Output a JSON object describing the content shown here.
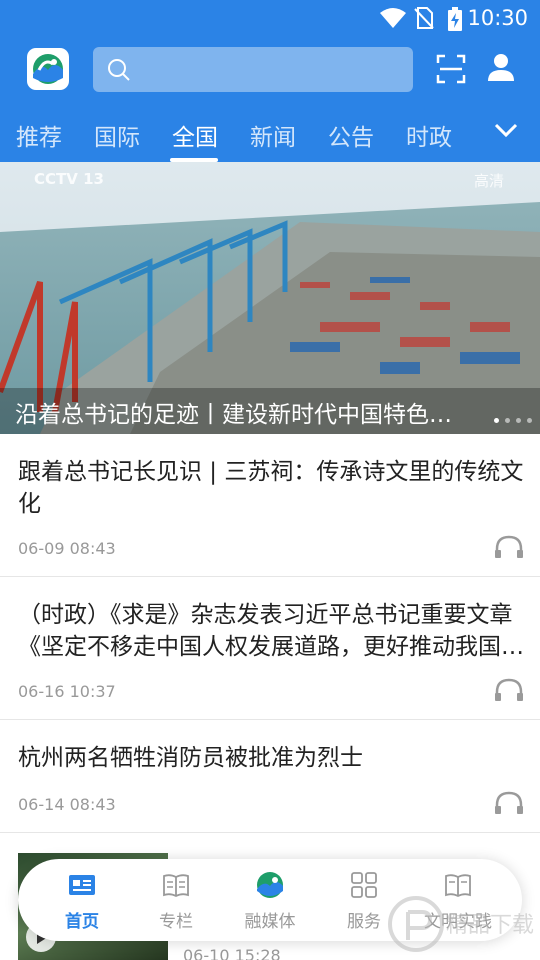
{
  "status_bar": {
    "time": "10:30",
    "icons": [
      "wifi-icon",
      "no-sim-icon",
      "battery-charging-icon"
    ]
  },
  "header": {
    "logo_icon": "app-logo-icon",
    "search": {
      "placeholder": "",
      "value": ""
    },
    "scan_icon": "scan-icon",
    "user_icon": "user-icon",
    "accent_color": "#2b83e6"
  },
  "tabs": {
    "items": [
      {
        "label": "推荐",
        "active": false
      },
      {
        "label": "国际",
        "active": false
      },
      {
        "label": "全国",
        "active": true
      },
      {
        "label": "新闻",
        "active": false
      },
      {
        "label": "公告",
        "active": false
      },
      {
        "label": "时政",
        "active": false
      }
    ],
    "more_icon": "chevron-down-icon"
  },
  "banner": {
    "channel_logo": "CCTV 13",
    "channel_sub": "新闻",
    "quality_badge": "高清",
    "caption": "沿着总书记的足迹丨建设新时代中国特色社会主义",
    "slide_count": 4,
    "active_slide": 0
  },
  "news": [
    {
      "title": "跟着总书记长见识 | 三苏祠：传承诗文里的传统文化",
      "date": "06-09 08:43",
      "listen_icon": "headphones-icon"
    },
    {
      "title": "（时政）《求是》杂志发表习近平总书记重要文章《坚定不移走中国人权发展道路，更好推动我国人权事业发展》",
      "date": "06-16 10:37",
      "listen_icon": "headphones-icon"
    },
    {
      "title": "杭州两名牺牲消防员被批准为烈士",
      "date": "06-14 08:43",
      "listen_icon": "headphones-icon"
    },
    {
      "title": "",
      "date": "06-10 15:28",
      "thumb_icon": "play-icon"
    }
  ],
  "bottom_nav": {
    "items": [
      {
        "label": "首页",
        "icon": "home-news-icon",
        "active": true
      },
      {
        "label": "专栏",
        "icon": "column-book-icon",
        "active": false
      },
      {
        "label": "融媒体",
        "icon": "media-logo-icon",
        "active": false
      },
      {
        "label": "服务",
        "icon": "grid-icon",
        "active": false
      },
      {
        "label": "文明实践",
        "icon": "practice-book-icon",
        "active": false
      }
    ]
  },
  "watermark": "精品下载"
}
